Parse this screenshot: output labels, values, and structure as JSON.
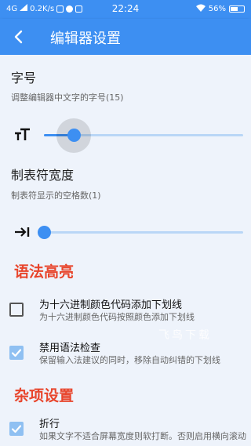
{
  "status_bar": {
    "network": "4G",
    "speed": "0.2K/s",
    "time": "22:24",
    "battery": "56%",
    "battery_level": 0.56
  },
  "app_bar": {
    "title": "编辑器设置",
    "back_icon": "arrow-back-icon"
  },
  "colors": {
    "primary": "#3d8ff2",
    "section_header": "#e8452c",
    "background": "#eef3fb",
    "checkbox_checked": "#8fc0f2"
  },
  "font_size": {
    "title": "字号",
    "summary": "调整编辑器中文字的字号(15)",
    "value": 15,
    "position": 0.15,
    "icon": "text-size-icon"
  },
  "tab_width": {
    "title": "制表符宽度",
    "summary": "制表符显示的空格数(1)",
    "value": 1,
    "position": 0.0,
    "icon": "tab-indent-icon"
  },
  "syntax_section": {
    "header": "语法高亮",
    "items": [
      {
        "title": "为十六进制颜色代码添加下划线",
        "summary": "为十六进制颜色代码按照颜色添加下划线",
        "checked": false
      },
      {
        "title": "禁用语法检查",
        "summary": "保留输入法建议的同时，移除自动纠错的下划线",
        "checked": true
      }
    ]
  },
  "misc_section": {
    "header": "杂项设置",
    "items": [
      {
        "title": "折行",
        "summary": "如果文字不适合屏幕宽度则软打断。否则启用横向滚动",
        "checked": true
      }
    ]
  },
  "watermark": "飞鸟下载"
}
